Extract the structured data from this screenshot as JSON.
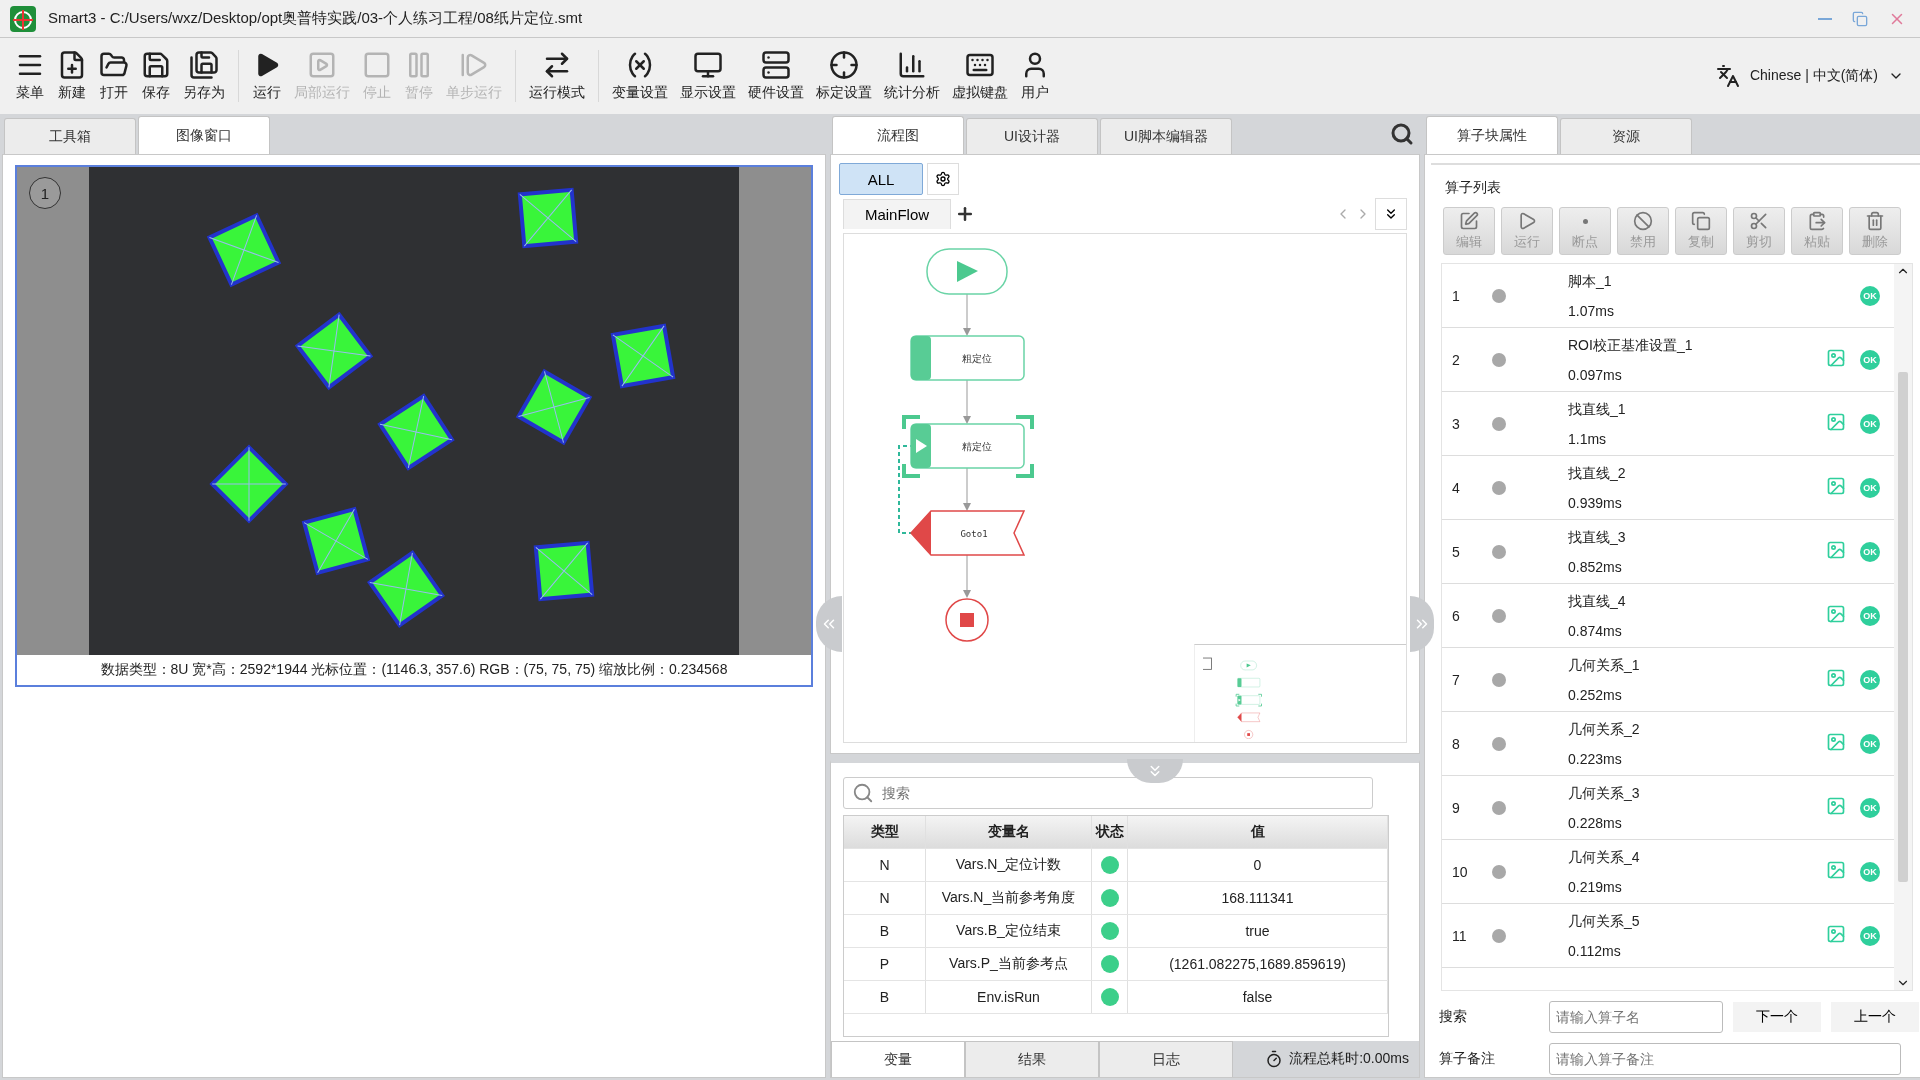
{
  "window": {
    "title": "Smart3 - C:/Users/wxz/Desktop/opt奥普特实践/03-个人练习工程/08纸片定位.smt"
  },
  "toolbar": [
    {
      "kind": "menu",
      "label": "菜单",
      "disabled": false
    },
    {
      "kind": "new",
      "label": "新建",
      "disabled": false
    },
    {
      "kind": "open",
      "label": "打开",
      "disabled": false
    },
    {
      "kind": "save",
      "label": "保存",
      "disabled": false
    },
    {
      "kind": "save-as",
      "label": "另存为",
      "disabled": false
    },
    {
      "kind": "run",
      "label": "运行",
      "disabled": false
    },
    {
      "kind": "run-part",
      "label": "局部运行",
      "disabled": true
    },
    {
      "kind": "stop",
      "label": "停止",
      "disabled": true
    },
    {
      "kind": "pause",
      "label": "暂停",
      "disabled": true
    },
    {
      "kind": "step",
      "label": "单步运行",
      "disabled": true
    },
    {
      "kind": "mode",
      "label": "运行模式",
      "disabled": false
    },
    {
      "kind": "variables",
      "label": "变量设置",
      "disabled": false
    },
    {
      "kind": "display",
      "label": "显示设置",
      "disabled": false
    },
    {
      "kind": "hardware",
      "label": "硬件设置",
      "disabled": false
    },
    {
      "kind": "calibration",
      "label": "标定设置",
      "disabled": false
    },
    {
      "kind": "statistics",
      "label": "统计分析",
      "disabled": false
    },
    {
      "kind": "keyboard",
      "label": "虚拟键盘",
      "disabled": false
    },
    {
      "kind": "user",
      "label": "用户",
      "disabled": false
    }
  ],
  "language": {
    "label": "Chinese | 中文(简体)"
  },
  "left_tabs": [
    {
      "label": "工具箱",
      "selected": false
    },
    {
      "label": "图像窗口",
      "selected": true
    }
  ],
  "image_view": {
    "badge": "1",
    "status": "数据类型：8U 宽*高：2592*1944 光标位置：(1146.3, 357.6) RGB：(75, 75, 75) 缩放比例：0.234568"
  },
  "flow_tabs": [
    {
      "label": "流程图",
      "selected": true
    },
    {
      "label": "UI设计器",
      "selected": false
    },
    {
      "label": "UI脚本编辑器",
      "selected": false
    }
  ],
  "flow_filter": {
    "label": "ALL",
    "selected": true
  },
  "flow_sheets": [
    {
      "label": "MainFlow",
      "selected": true
    }
  ],
  "flow_nodes": [
    {
      "kind": "start"
    },
    {
      "kind": "process",
      "label": "粗定位",
      "selected": false
    },
    {
      "kind": "process",
      "label": "精定位",
      "selected": true
    },
    {
      "kind": "goto",
      "label": "Goto1"
    },
    {
      "kind": "end"
    }
  ],
  "variables": {
    "placeholder": "搜索",
    "columns": [
      "类型",
      "变量名",
      "状态",
      "值"
    ],
    "rows": [
      {
        "type": "N",
        "name": "Vars.N_定位计数",
        "value": "0"
      },
      {
        "type": "N",
        "name": "Vars.N_当前参考角度",
        "value": "168.111341"
      },
      {
        "type": "B",
        "name": "Vars.B_定位结束",
        "value": "true"
      },
      {
        "type": "P",
        "name": "Vars.P_当前参考点",
        "value": "(1261.082275,1689.859619)"
      },
      {
        "type": "B",
        "name": "Env.isRun",
        "value": "false"
      }
    ]
  },
  "bottom_tabs": [
    {
      "label": "变量",
      "selected": true
    },
    {
      "label": "结果",
      "selected": false
    },
    {
      "label": "日志",
      "selected": false
    }
  ],
  "elapsed": "流程总耗时:0.00ms",
  "props_tabs": [
    {
      "label": "算子块属性",
      "selected": true
    },
    {
      "label": "资源",
      "selected": false
    }
  ],
  "operator_list": {
    "title": "算子列表",
    "tools": [
      {
        "kind": "edit",
        "label": "编辑"
      },
      {
        "kind": "run",
        "label": "运行"
      },
      {
        "kind": "breakpoint",
        "label": "断点"
      },
      {
        "kind": "disable",
        "label": "禁用"
      },
      {
        "kind": "copy",
        "label": "复制"
      },
      {
        "kind": "cut",
        "label": "剪切"
      },
      {
        "kind": "paste",
        "label": "粘贴"
      },
      {
        "kind": "delete",
        "label": "删除"
      }
    ],
    "items": [
      {
        "index": "1",
        "name": "脚本_1",
        "time": "1.07ms",
        "has_image": false,
        "status": "OK"
      },
      {
        "index": "2",
        "name": "ROI校正基准设置_1",
        "time": "0.097ms",
        "has_image": true,
        "status": "OK"
      },
      {
        "index": "3",
        "name": "找直线_1",
        "time": "1.1ms",
        "has_image": true,
        "status": "OK"
      },
      {
        "index": "4",
        "name": "找直线_2",
        "time": "0.939ms",
        "has_image": true,
        "status": "OK"
      },
      {
        "index": "5",
        "name": "找直线_3",
        "time": "0.852ms",
        "has_image": true,
        "status": "OK"
      },
      {
        "index": "6",
        "name": "找直线_4",
        "time": "0.874ms",
        "has_image": true,
        "status": "OK"
      },
      {
        "index": "7",
        "name": "几何关系_1",
        "time": "0.252ms",
        "has_image": true,
        "status": "OK"
      },
      {
        "index": "8",
        "name": "几何关系_2",
        "time": "0.223ms",
        "has_image": true,
        "status": "OK"
      },
      {
        "index": "9",
        "name": "几何关系_3",
        "time": "0.228ms",
        "has_image": true,
        "status": "OK"
      },
      {
        "index": "10",
        "name": "几何关系_4",
        "time": "0.219ms",
        "has_image": true,
        "status": "OK"
      },
      {
        "index": "11",
        "name": "几何关系_5",
        "time": "0.112ms",
        "has_image": true,
        "status": "OK"
      }
    ]
  },
  "operator_search": {
    "label": "搜索",
    "placeholder": "请输入算子名",
    "buttons": [
      "下一个",
      "上一个"
    ]
  },
  "operator_remark": {
    "label": "算子备注",
    "placeholder": "请输入算子备注"
  }
}
